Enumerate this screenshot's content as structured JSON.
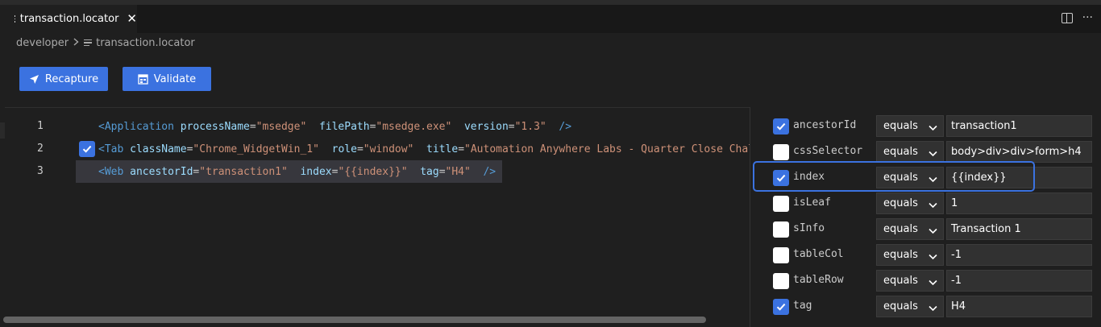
{
  "tab": {
    "title": "transaction.locator",
    "close_glyph": "✕"
  },
  "tab_actions": {
    "split_icon": "split-editor-icon",
    "more_glyph": "···"
  },
  "breadcrumb": {
    "root": "developer",
    "file": "transaction.locator"
  },
  "toolbar": {
    "recapture_label": "Recapture",
    "validate_label": "Validate"
  },
  "colors": {
    "accent": "#3b72e0",
    "tag": "#569cd6",
    "attr": "#9cdcfe",
    "string": "#ce9178"
  },
  "editor": {
    "lines": [
      {
        "num": "1",
        "tag": "Application",
        "checked": null,
        "attrs": [
          {
            "name": "processName",
            "value": "\"msedge\""
          },
          {
            "name": "filePath",
            "value": "\"msedge.exe\""
          },
          {
            "name": "version",
            "value": "\"1.3\""
          }
        ],
        "close": "/>"
      },
      {
        "num": "2",
        "tag": "Tab",
        "checked": true,
        "attrs": [
          {
            "name": "className",
            "value": "\"Chrome_WidgetWin_1\""
          },
          {
            "name": "role",
            "value": "\"window\""
          },
          {
            "name": "title",
            "value": "\"Automation Anywhere Labs - Quarter Close Challe"
          }
        ],
        "close": ""
      },
      {
        "num": "3",
        "tag": "Web",
        "checked": true,
        "attrs": [
          {
            "name": "ancestorId",
            "value": "\"transaction1\""
          },
          {
            "name": "index",
            "value": "\"{{index}}\""
          },
          {
            "name": "tag",
            "value": "\"H4\""
          }
        ],
        "close": "/>"
      }
    ]
  },
  "properties": [
    {
      "name": "ancestorId",
      "checked": true,
      "op": "equals",
      "value": "transaction1"
    },
    {
      "name": "cssSelector",
      "checked": false,
      "op": "equals",
      "value": "body>div>div>form>h4"
    },
    {
      "name": "index",
      "checked": true,
      "op": "equals",
      "value": "{{index}}"
    },
    {
      "name": "isLeaf",
      "checked": false,
      "op": "equals",
      "value": "1"
    },
    {
      "name": "sInfo",
      "checked": false,
      "op": "equals",
      "value": "Transaction 1"
    },
    {
      "name": "tableCol",
      "checked": false,
      "op": "equals",
      "value": "-1"
    },
    {
      "name": "tableRow",
      "checked": false,
      "op": "equals",
      "value": "-1"
    },
    {
      "name": "tag",
      "checked": true,
      "op": "equals",
      "value": "H4"
    }
  ]
}
